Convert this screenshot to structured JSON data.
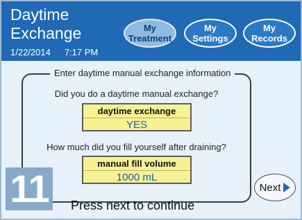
{
  "header": {
    "title_line1": "Daytime",
    "title_line2": "Exchange",
    "date": "1/22/2014",
    "time": "7:17 PM"
  },
  "nav": [
    {
      "line1": "My",
      "line2": "Treatment",
      "active": true
    },
    {
      "line1": "My",
      "line2": "Settings",
      "active": false
    },
    {
      "line1": "My",
      "line2": "Records",
      "active": false
    }
  ],
  "panel": {
    "legend": "Enter daytime manual exchange information",
    "question1": "Did you do a daytime manual exchange?",
    "answer1_label": "daytime exchange",
    "answer1_value": "YES",
    "question2": "How much did you fill yourself after draining?",
    "answer2_label": "manual fill volume",
    "answer2_value": "1000 mL"
  },
  "footer": {
    "step_number": "11",
    "instruction": "Press next to continue",
    "next_label": "Next"
  },
  "colors": {
    "header_blue": "#1f69b5",
    "background": "#e6f1fa",
    "answer_yellow": "#f6f292",
    "value_blue": "#1b5bb1"
  },
  "icons": {
    "next": "play-triangle-right"
  }
}
